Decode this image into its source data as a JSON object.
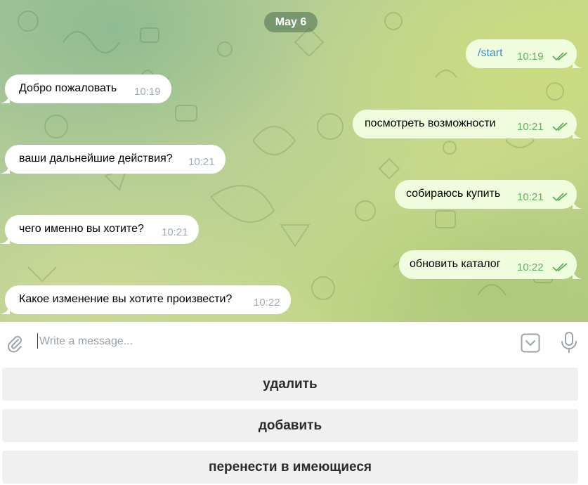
{
  "chat": {
    "date_label": "May 6",
    "messages": [
      {
        "direction": "out",
        "text": "/start",
        "time": "10:19",
        "read": true,
        "is_command": true
      },
      {
        "direction": "in",
        "text": "Добро пожаловать",
        "time": "10:19"
      },
      {
        "direction": "out",
        "text": "посмотреть возможности",
        "time": "10:21",
        "read": true
      },
      {
        "direction": "in",
        "text": "ваши дальнейшие действия?",
        "time": "10:21"
      },
      {
        "direction": "out",
        "text": "собираюсь купить",
        "time": "10:21",
        "read": true
      },
      {
        "direction": "in",
        "text": "чего именно вы хотите?",
        "time": "10:21"
      },
      {
        "direction": "out",
        "text": "обновить каталог",
        "time": "10:22",
        "read": true
      },
      {
        "direction": "in",
        "text": "Какое изменение вы хотите произвести?",
        "time": "10:22"
      }
    ]
  },
  "composer": {
    "placeholder": "Write a message...",
    "value": "",
    "icons": {
      "attach": "paperclip-icon",
      "keyboard_toggle": "chevron-down-icon",
      "voice": "microphone-icon"
    }
  },
  "keyboard": {
    "buttons": [
      {
        "label": "удалить"
      },
      {
        "label": "добавить"
      },
      {
        "label": "перенести в имеющиеся"
      }
    ]
  },
  "colors": {
    "incoming_bubble": "#ffffff",
    "outgoing_bubble": "#effdde",
    "outgoing_time": "#5fb05a",
    "incoming_time": "#a0acb6",
    "command_link": "#3b8fc4",
    "date_pill": "#6e8f6a",
    "keyboard_button": "#f0f0f0"
  }
}
